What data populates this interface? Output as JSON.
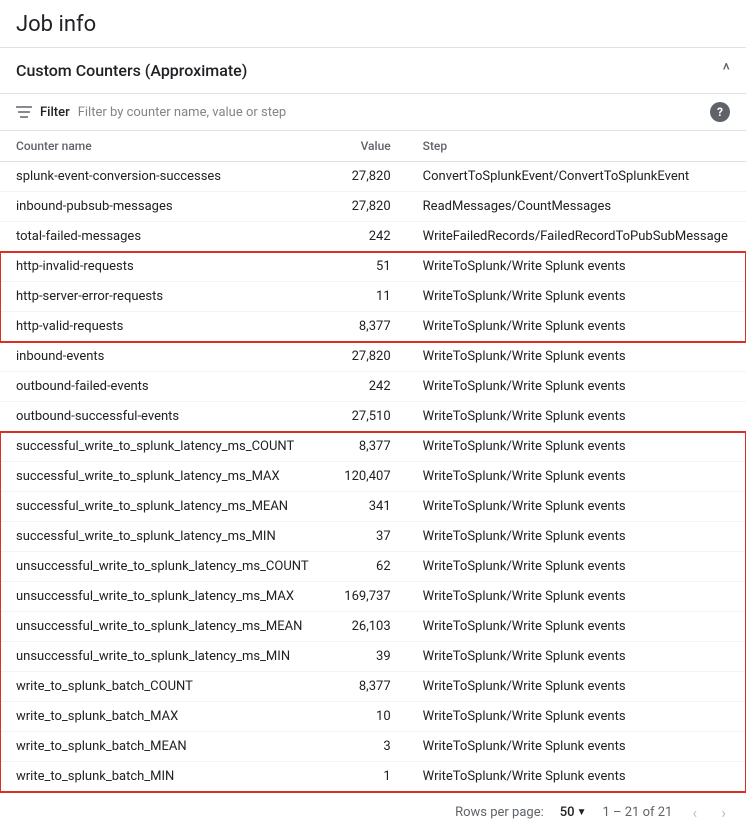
{
  "page": {
    "title": "Job info",
    "section_title": "Custom Counters (Approximate)",
    "filter_label": "Filter",
    "filter_placeholder": "Filter by counter name, value or step",
    "collapse_symbol": "^",
    "help_symbol": "?"
  },
  "table": {
    "columns": [
      {
        "key": "name",
        "label": "Counter name"
      },
      {
        "key": "value",
        "label": "Value"
      },
      {
        "key": "step",
        "label": "Step"
      }
    ],
    "rows": [
      {
        "name": "splunk-event-conversion-successes",
        "value": "27,820",
        "step": "ConvertToSplunkEvent/ConvertToSplunkEvent",
        "group": ""
      },
      {
        "name": "inbound-pubsub-messages",
        "value": "27,820",
        "step": "ReadMessages/CountMessages",
        "group": ""
      },
      {
        "name": "total-failed-messages",
        "value": "242",
        "step": "WriteFailedRecords/FailedRecordToPubSubMessage",
        "group": ""
      },
      {
        "name": "http-invalid-requests",
        "value": "51",
        "step": "WriteToSplunk/Write Splunk events",
        "group": "red-a"
      },
      {
        "name": "http-server-error-requests",
        "value": "11",
        "step": "WriteToSplunk/Write Splunk events",
        "group": "red-a"
      },
      {
        "name": "http-valid-requests",
        "value": "8,377",
        "step": "WriteToSplunk/Write Splunk events",
        "group": "red-a"
      },
      {
        "name": "inbound-events",
        "value": "27,820",
        "step": "WriteToSplunk/Write Splunk events",
        "group": ""
      },
      {
        "name": "outbound-failed-events",
        "value": "242",
        "step": "WriteToSplunk/Write Splunk events",
        "group": ""
      },
      {
        "name": "outbound-successful-events",
        "value": "27,510",
        "step": "WriteToSplunk/Write Splunk events",
        "group": ""
      },
      {
        "name": "successful_write_to_splunk_latency_ms_COUNT",
        "value": "8,377",
        "step": "WriteToSplunk/Write Splunk events",
        "group": "red-b"
      },
      {
        "name": "successful_write_to_splunk_latency_ms_MAX",
        "value": "120,407",
        "step": "WriteToSplunk/Write Splunk events",
        "group": "red-b"
      },
      {
        "name": "successful_write_to_splunk_latency_ms_MEAN",
        "value": "341",
        "step": "WriteToSplunk/Write Splunk events",
        "group": "red-b"
      },
      {
        "name": "successful_write_to_splunk_latency_ms_MIN",
        "value": "37",
        "step": "WriteToSplunk/Write Splunk events",
        "group": "red-b"
      },
      {
        "name": "unsuccessful_write_to_splunk_latency_ms_COUNT",
        "value": "62",
        "step": "WriteToSplunk/Write Splunk events",
        "group": "red-b"
      },
      {
        "name": "unsuccessful_write_to_splunk_latency_ms_MAX",
        "value": "169,737",
        "step": "WriteToSplunk/Write Splunk events",
        "group": "red-b"
      },
      {
        "name": "unsuccessful_write_to_splunk_latency_ms_MEAN",
        "value": "26,103",
        "step": "WriteToSplunk/Write Splunk events",
        "group": "red-b"
      },
      {
        "name": "unsuccessful_write_to_splunk_latency_ms_MIN",
        "value": "39",
        "step": "WriteToSplunk/Write Splunk events",
        "group": "red-b"
      },
      {
        "name": "write_to_splunk_batch_COUNT",
        "value": "8,377",
        "step": "WriteToSplunk/Write Splunk events",
        "group": "red-b"
      },
      {
        "name": "write_to_splunk_batch_MAX",
        "value": "10",
        "step": "WriteToSplunk/Write Splunk events",
        "group": "red-b"
      },
      {
        "name": "write_to_splunk_batch_MEAN",
        "value": "3",
        "step": "WriteToSplunk/Write Splunk events",
        "group": "red-b"
      },
      {
        "name": "write_to_splunk_batch_MIN",
        "value": "1",
        "step": "WriteToSplunk/Write Splunk events",
        "group": "red-b"
      }
    ]
  },
  "footer": {
    "rows_per_page_label": "Rows per page:",
    "rows_per_page_value": "50",
    "rows_per_page_arrow": "▼",
    "page_range": "1 – 21 of 21",
    "prev_arrow": "‹",
    "next_arrow": "›"
  }
}
